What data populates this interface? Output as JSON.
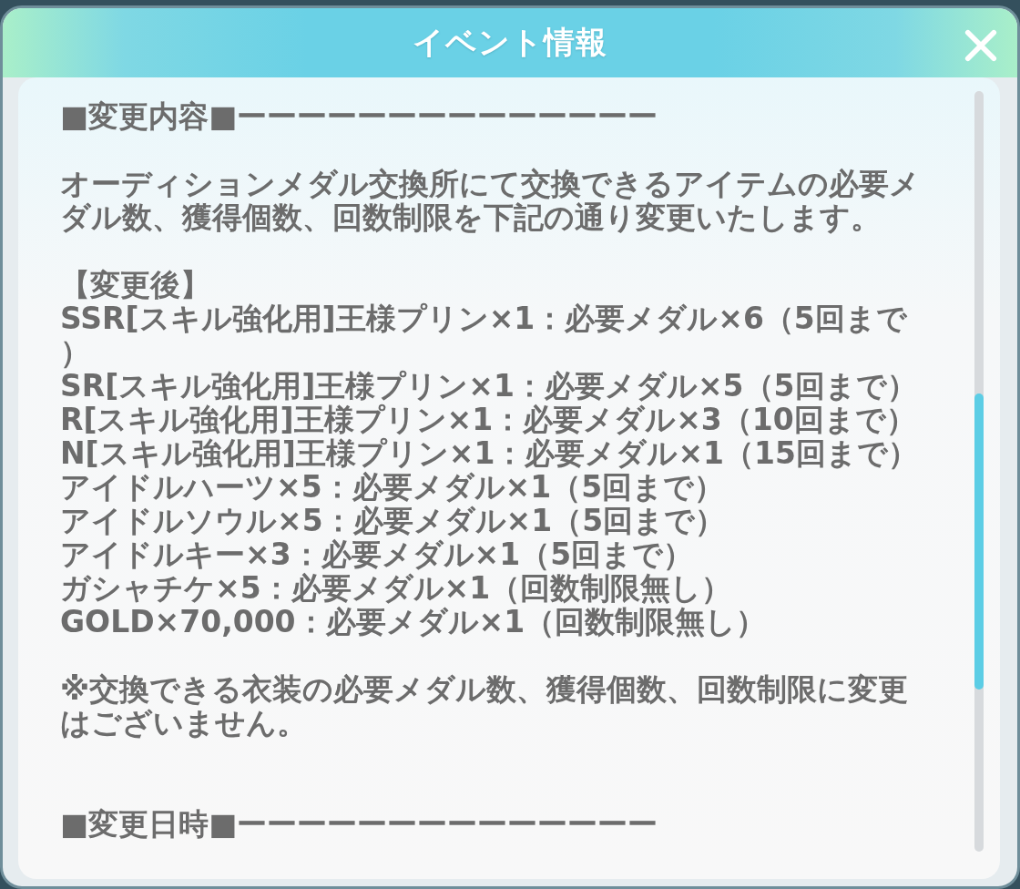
{
  "dialog": {
    "title": "イベント情報"
  },
  "blocks": [
    {
      "kind": "heading",
      "text": "■変更内容■ーーーーーーーーーーーーーー"
    },
    {
      "kind": "paragraph",
      "text": "オーディションメダル交換所にて交換できるアイテムの必要メダル数、獲得個数、回数制限を下記の通り変更いたします。"
    },
    {
      "kind": "list",
      "title": "【変更後】",
      "items": [
        "SSR[スキル強化用]王様プリン×1：必要メダル×6（5回まで）",
        "SR[スキル強化用]王様プリン×1：必要メダル×5（5回まで）",
        "R[スキル強化用]王様プリン×1：必要メダル×3（10回まで）",
        "N[スキル強化用]王様プリン×1：必要メダル×1（15回まで）",
        "アイドルハーツ×5：必要メダル×1（5回まで）",
        "アイドルソウル×5：必要メダル×1（5回まで）",
        "アイドルキー×3：必要メダル×1（5回まで）",
        "ガシャチケ×5：必要メダル×1（回数制限無し）",
        "GOLD×70,000：必要メダル×1（回数制限無し）"
      ]
    },
    {
      "kind": "paragraph",
      "text": "※交換できる衣装の必要メダル数、獲得個数、回数制限に変更はございません。"
    },
    {
      "kind": "heading",
      "text": "■変更日時■ーーーーーーーーーーーーーー"
    }
  ]
}
